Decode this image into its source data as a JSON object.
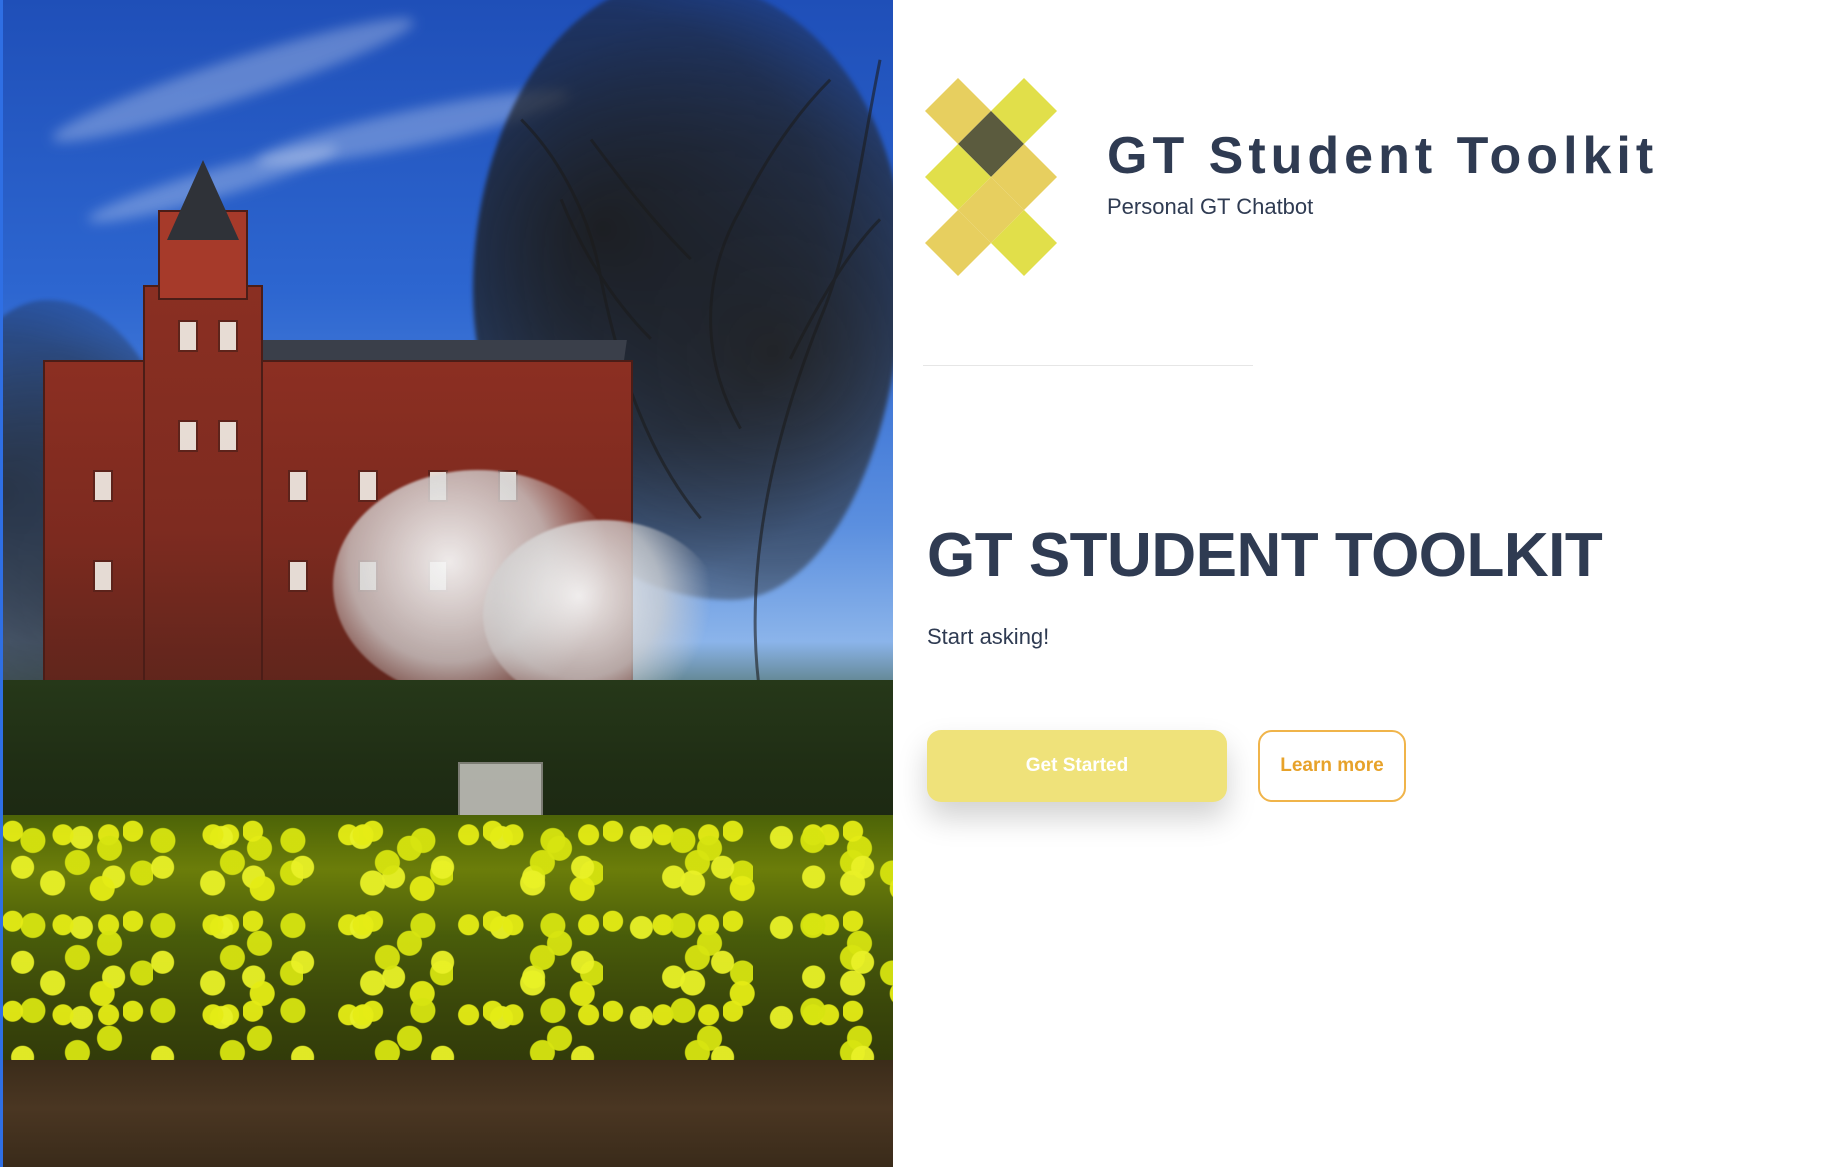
{
  "brand": {
    "title": "GT Student Toolkit",
    "subtitle": "Personal GT Chatbot",
    "logo_icon": "gt-x-logo-icon",
    "colors": {
      "logo_light": "#e7cf5f",
      "logo_lime": "#e1df4a",
      "logo_dark": "#5b5b3e"
    }
  },
  "hero": {
    "heading": "GT STUDENT TOOLKIT",
    "subheading": "Start asking!",
    "image_icon": "campus-photo-image"
  },
  "actions": {
    "get_started_label": "Get Started",
    "learn_more_label": "Learn more",
    "colors": {
      "primary_bg": "#efe27a",
      "secondary_border": "#f0b44a",
      "secondary_text": "#e7a22a"
    }
  },
  "theme": {
    "text_primary": "#2f3b52",
    "page_bg": "#ffffff",
    "left_accent": "#2f6fe4"
  }
}
